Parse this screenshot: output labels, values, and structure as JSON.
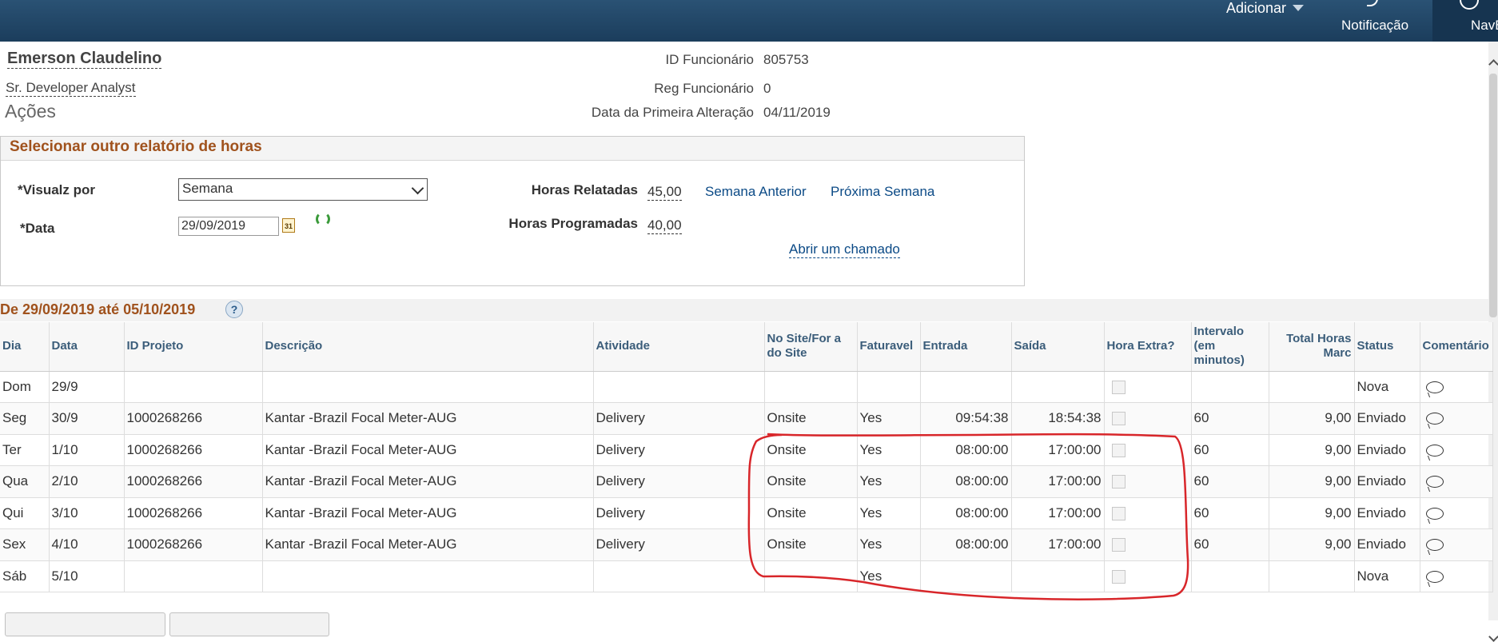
{
  "topbar": {
    "add_label": "Adicionar",
    "notifications_label": "Notificação",
    "navbar_label": "NavBar"
  },
  "employee": {
    "name": "Emerson Claudelino",
    "title": "Sr. Developer Analyst",
    "id_label": "ID Funcionário",
    "id_value": "805753",
    "reg_label": "Reg Funcionário",
    "reg_value": "0",
    "first_change_label": "Data da Primeira Alteração",
    "first_change_value": "04/11/2019"
  },
  "actions_label": "Ações",
  "select_box": {
    "header": "Selecionar outro relatório de horas",
    "view_by_label": "*Visualz por",
    "view_by_value": "Semana",
    "date_label": "*Data",
    "date_value": "29/09/2019",
    "calendar_icon_text": "31",
    "reported_hours_label": "Horas Relatadas",
    "reported_hours_value": "45,00",
    "scheduled_hours_label": "Horas Programadas",
    "scheduled_hours_value": "40,00",
    "prev_week": "Semana Anterior",
    "next_week": "Próxima Semana",
    "open_ticket": "Abrir um chamado"
  },
  "range_title": "De 29/09/2019 até 05/10/2019",
  "help_glyph": "?",
  "grid": {
    "headers": [
      "Dia",
      "Data",
      "ID Projeto",
      "Descrição",
      "Atividade",
      "No Site/For a do Site",
      "Faturavel",
      "Entrada",
      "Saída",
      "Hora Extra?",
      "Intervalo (em minutos)",
      "Total Horas Marc",
      "Status",
      "Comentário"
    ],
    "rows": [
      [
        "Dom",
        "29/9",
        "",
        "",
        "",
        "",
        "",
        "",
        "",
        "",
        "",
        "",
        "Nova"
      ],
      [
        "Seg",
        "30/9",
        "1000268266",
        "Kantar -Brazil Focal Meter-AUG",
        "Delivery",
        "Onsite",
        "Yes",
        "09:54:38",
        "18:54:38",
        "",
        "60",
        "9,00",
        "Enviado"
      ],
      [
        "Ter",
        "1/10",
        "1000268266",
        "Kantar -Brazil Focal Meter-AUG",
        "Delivery",
        "Onsite",
        "Yes",
        "08:00:00",
        "17:00:00",
        "",
        "60",
        "9,00",
        "Enviado"
      ],
      [
        "Qua",
        "2/10",
        "1000268266",
        "Kantar -Brazil Focal Meter-AUG",
        "Delivery",
        "Onsite",
        "Yes",
        "08:00:00",
        "17:00:00",
        "",
        "60",
        "9,00",
        "Enviado"
      ],
      [
        "Qui",
        "3/10",
        "1000268266",
        "Kantar -Brazil Focal Meter-AUG",
        "Delivery",
        "Onsite",
        "Yes",
        "08:00:00",
        "17:00:00",
        "",
        "60",
        "9,00",
        "Enviado"
      ],
      [
        "Sex",
        "4/10",
        "1000268266",
        "Kantar -Brazil Focal Meter-AUG",
        "Delivery",
        "Onsite",
        "Yes",
        "08:00:00",
        "17:00:00",
        "",
        "60",
        "9,00",
        "Enviado"
      ],
      [
        "Sáb",
        "5/10",
        "",
        "",
        "",
        "",
        "Yes",
        "",
        "",
        "",
        "",
        "",
        "Nova"
      ]
    ]
  },
  "annotation_color": "#d8262a"
}
